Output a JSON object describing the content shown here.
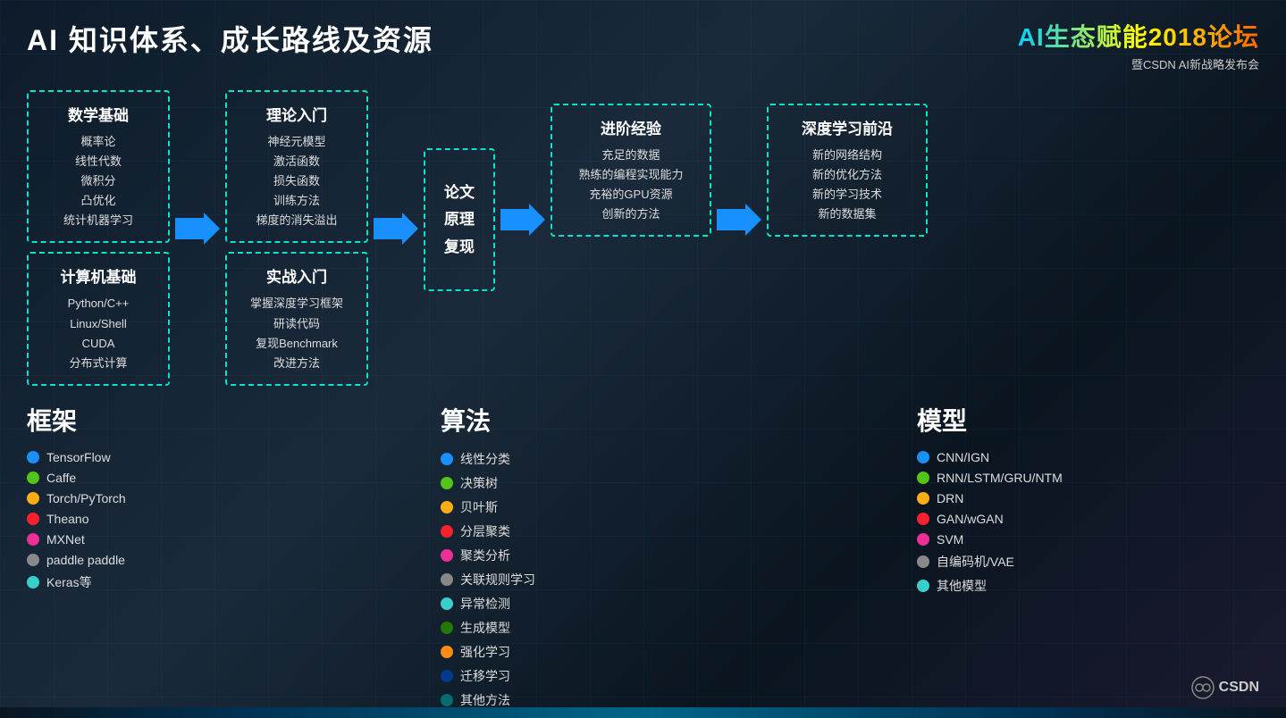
{
  "header": {
    "main_title": "AI 知识体系、成长路线及资源",
    "logo_title": "AI生态赋能2018论坛",
    "logo_subtitle": "暨CSDN AI新战略发布会"
  },
  "flow": {
    "box1": {
      "section1_title": "数学基础",
      "section1_items": [
        "概率论",
        "线性代数",
        "微积分",
        "凸优化",
        "统计机器学习"
      ],
      "section2_title": "计算机基础",
      "section2_items": [
        "Python/C++",
        "Linux/Shell",
        "CUDA",
        "分布式计算"
      ]
    },
    "box2": {
      "section1_title": "理论入门",
      "section1_items": [
        "神经元模型",
        "激活函数",
        "损失函数",
        "训练方法",
        "梯度的消失溢出"
      ],
      "section2_title": "实战入门",
      "section2_items": [
        "掌握深度学习框架",
        "研读代码",
        "复现Benchmark",
        "改进方法"
      ]
    },
    "box3": {
      "title": "论文\n原理\n复现"
    },
    "box4": {
      "title": "进阶经验",
      "items": [
        "充足的数据",
        "熟练的编程实现能力",
        "充裕的GPU资源",
        "创新的方法"
      ]
    },
    "box5": {
      "title": "深度学习前沿",
      "items": [
        "新的网络结构",
        "新的优化方法",
        "新的学习技术",
        "新的数据集"
      ]
    }
  },
  "frameworks": {
    "label": "框架",
    "items": [
      {
        "color": "#1890ff",
        "text": "TensorFlow"
      },
      {
        "color": "#52c41a",
        "text": "Caffe"
      },
      {
        "color": "#faad14",
        "text": "Torch/PyTorch"
      },
      {
        "color": "#f5222d",
        "text": "Theano"
      },
      {
        "color": "#eb2f96",
        "text": "MXNet"
      },
      {
        "color": "#888888",
        "text": "paddle paddle"
      },
      {
        "color": "#36cfc9",
        "text": "Keras等"
      }
    ]
  },
  "algorithms": {
    "label": "算法",
    "items": [
      {
        "color": "#1890ff",
        "text": "线性分类"
      },
      {
        "color": "#52c41a",
        "text": "决策树"
      },
      {
        "color": "#faad14",
        "text": "贝叶斯"
      },
      {
        "color": "#f5222d",
        "text": "分层聚类"
      },
      {
        "color": "#eb2f96",
        "text": "聚类分析"
      },
      {
        "color": "#888888",
        "text": "关联规则学习"
      },
      {
        "color": "#36cfc9",
        "text": "异常检测"
      },
      {
        "color": "#237804",
        "text": "生成模型"
      },
      {
        "color": "#fa8c16",
        "text": "强化学习"
      },
      {
        "color": "#003a8c",
        "text": "迁移学习"
      },
      {
        "color": "#006d75",
        "text": "其他方法"
      }
    ]
  },
  "models": {
    "label": "模型",
    "items": [
      {
        "color": "#1890ff",
        "text": "CNN/IGN"
      },
      {
        "color": "#52c41a",
        "text": "RNN/LSTM/GRU/NTM"
      },
      {
        "color": "#faad14",
        "text": "DRN"
      },
      {
        "color": "#f5222d",
        "text": "GAN/wGAN"
      },
      {
        "color": "#eb2f96",
        "text": "SVM"
      },
      {
        "color": "#888888",
        "text": "自编码机/VAE"
      },
      {
        "color": "#36cfc9",
        "text": "其他模型"
      }
    ]
  },
  "csdn": {
    "label": "CSDN"
  }
}
